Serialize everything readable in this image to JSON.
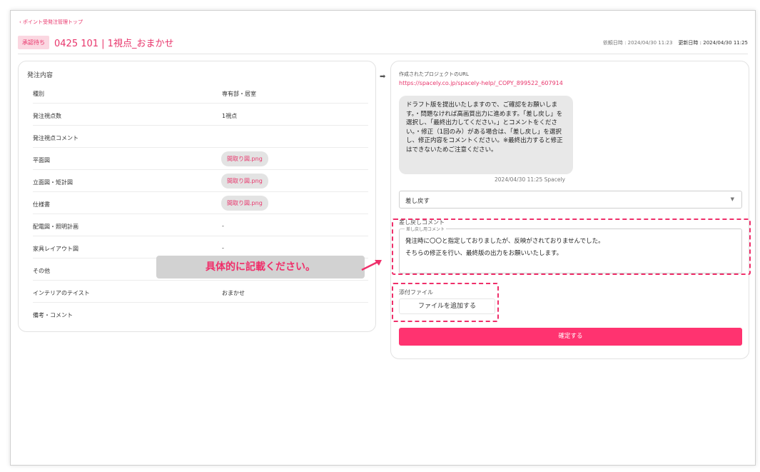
{
  "header": {
    "back_link": "‹ ポイント受発注管理トップ",
    "status_badge": "承認待ち",
    "title": "0425 101 | 1視点_おまかせ",
    "requested_at": "依頼日時 : 2024/04/30 11:23",
    "updated_at": "更新日時 : 2024/04/30 11:25"
  },
  "order": {
    "section_title": "発注内容",
    "rows": [
      {
        "label": "種別",
        "value": "専有部・居室"
      },
      {
        "label": "発注視点数",
        "value": "1視点"
      },
      {
        "label": "発注視点コメント",
        "value": ""
      },
      {
        "label": "平面図",
        "file": "間取り図.png"
      },
      {
        "label": "立面図・矩計図",
        "file": "間取り図.png"
      },
      {
        "label": "仕様書",
        "file": "間取り図.png"
      },
      {
        "label": "配電図・照明計画",
        "value": "-"
      },
      {
        "label": "家具レイアウト図",
        "value": "-"
      },
      {
        "label": "その他",
        "value": ""
      },
      {
        "label": "インテリアのテイスト",
        "value": "おまかせ"
      },
      {
        "label": "備考・コメント",
        "value": ""
      }
    ]
  },
  "project": {
    "url_label": "作成されたプロジェクトのURL",
    "url": "https://spacely.co.jp/spacely-help/_COPY_899522_607914"
  },
  "message": {
    "text": "ドラフト版を提出いたしますので、ご確認をお願いします。・問題なければ高画質出力に進めます。「差し戻し」を選択し、「最終出力してください。」とコメントをください。・修正（1回のみ）がある場合は、「差し戻し」を選択し、修正内容をコメントください。※最終出力すると修正はできないためご注意ください。",
    "meta": "2024/04/30 11:25 Spacely"
  },
  "action_select": {
    "selected": "差し戻す"
  },
  "comment": {
    "label": "差し戻しコメント",
    "legend": "差し戻し用コメント",
    "line1": "発注時に〇〇と指定しておりましたが、反映がされておりませんでした。",
    "line2": "そちらの修正を行い、最終版の出力をお願いいたします。"
  },
  "attachment": {
    "label": "添付ファイル",
    "button": "ファイルを追加する"
  },
  "confirm_button": "確定する",
  "callout": "具体的に記載ください。",
  "colors": {
    "accent": "#ff3370",
    "annotation": "#ef2f6a"
  }
}
